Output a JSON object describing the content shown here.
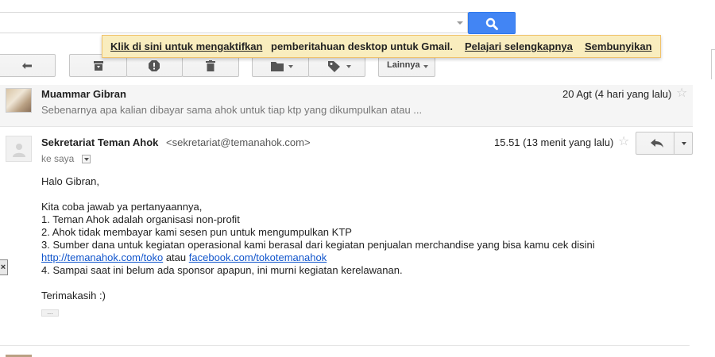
{
  "search": {
    "placeholder": "",
    "icon": "search-icon",
    "accent": "#4285f4"
  },
  "notification": {
    "enable_link": "Klik di sini untuk mengaktifkan",
    "text": "pemberitahuan desktop untuk Gmail.",
    "learn_more": "Pelajari selengkapnya",
    "hide": "Sembunyikan",
    "background": "#f9edbe"
  },
  "toolbar": {
    "back_icon": "back-arrow-icon",
    "archive_icon": "archive-icon",
    "spam_icon": "report-spam-icon",
    "delete_icon": "trash-icon",
    "move_icon": "folder-icon",
    "labels_icon": "label-tag-icon",
    "more_label": "Lainnya"
  },
  "messages": [
    {
      "sender": "Muammar Gibran",
      "snippet": "Sebenarnya apa kalian dibayar sama ahok untuk tiap ktp yang dikumpulkan atau ...",
      "date": "20 Agt (4 hari yang lalu)"
    },
    {
      "sender": "Sekretariat Teman Ahok",
      "email": "<sekretariat@temanahok.com>",
      "recipient": "ke saya",
      "date": "15.51 (13 menit yang lalu)",
      "body": {
        "greeting": "Halo Gibran,",
        "intro": "Kita coba jawab ya pertanyaannya,",
        "point1": "1. Teman Ahok adalah organisasi non-profit",
        "point2": "2. Ahok tidak membayar kami sesen pun untuk mengumpulkan KTP",
        "point3": "3. Sumber dana untuk kegiatan operasional kami berasal dari kegiatan penjualan merchandise yang bisa kamu cek disini",
        "link1": "http://temanahok.com/toko",
        "link_joiner": "atau",
        "link2": "facebook.com/tokotemanahok",
        "point4": "4. Sampai saat ini belum ada sponsor apapun, ini murni kegiatan kerelawanan.",
        "closing": "Terimakasih :)"
      },
      "more_dots": "..."
    }
  ],
  "side_close": "×"
}
